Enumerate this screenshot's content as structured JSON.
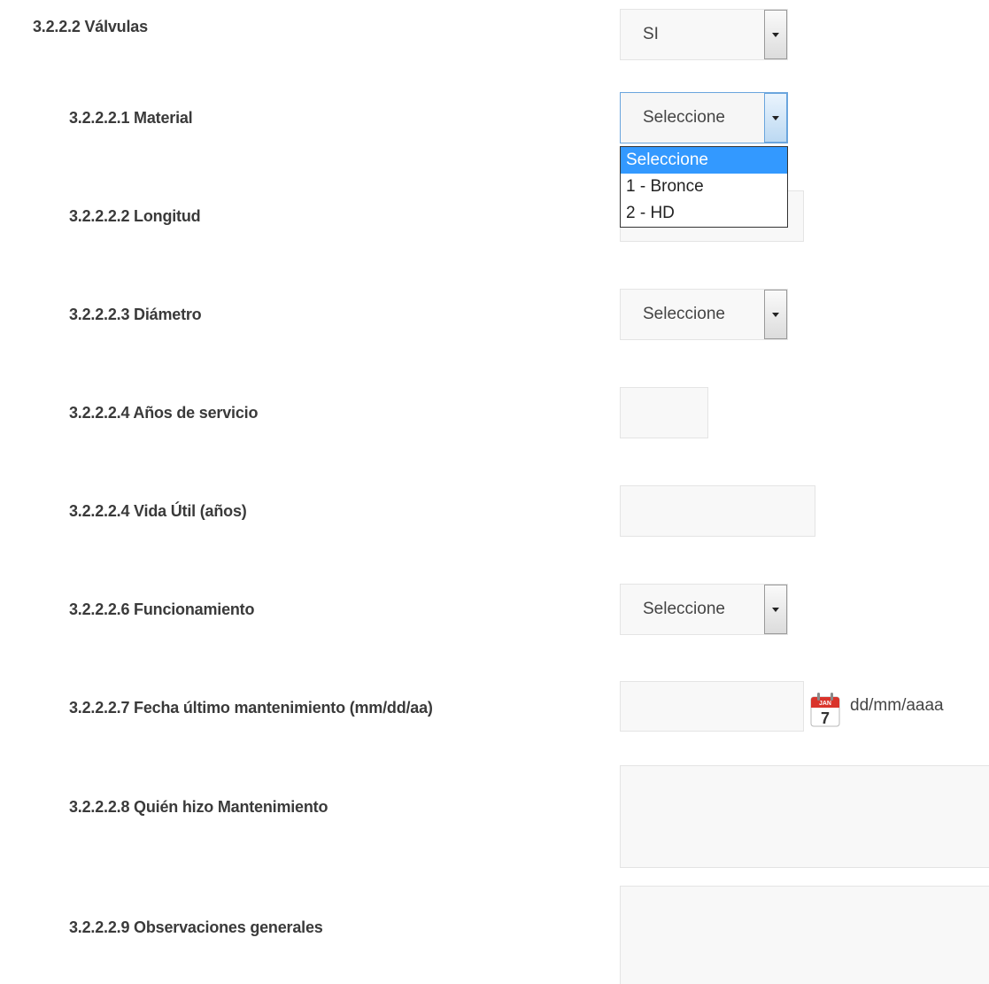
{
  "section": {
    "label": "3.2.2.2 Válvulas",
    "select_value": "SI"
  },
  "fields": {
    "material": {
      "label": "3.2.2.2.1 Material",
      "select_value": "Seleccione"
    },
    "material_options": [
      "Seleccione",
      "1 - Bronce",
      "2 - HD"
    ],
    "longitud": {
      "label": "3.2.2.2.2 Longitud",
      "value": ""
    },
    "diametro": {
      "label": "3.2.2.2.3 Diámetro",
      "select_value": "Seleccione"
    },
    "anos_servicio": {
      "label": "3.2.2.2.4 Años de servicio",
      "value": ""
    },
    "vida_util": {
      "label": "3.2.2.2.4 Vida Útil (años)",
      "value": ""
    },
    "funcionamiento": {
      "label": "3.2.2.2.6 Funcionamiento",
      "select_value": "Seleccione"
    },
    "fecha": {
      "label": "3.2.2.2.7 Fecha último mantenimiento (mm/dd/aa)",
      "value": "",
      "hint": "dd/mm/aaaa",
      "calendar_month": "JAN",
      "calendar_day": "7"
    },
    "quien": {
      "label": "3.2.2.2.8 Quién hizo Mantenimiento",
      "value": ""
    },
    "observaciones": {
      "label": "3.2.2.2.9 Observaciones generales",
      "value": ""
    }
  },
  "colors": {
    "selected_option_bg": "#3399ff",
    "input_bg": "#f8f8f8",
    "calendar_red": "#d9342b"
  }
}
